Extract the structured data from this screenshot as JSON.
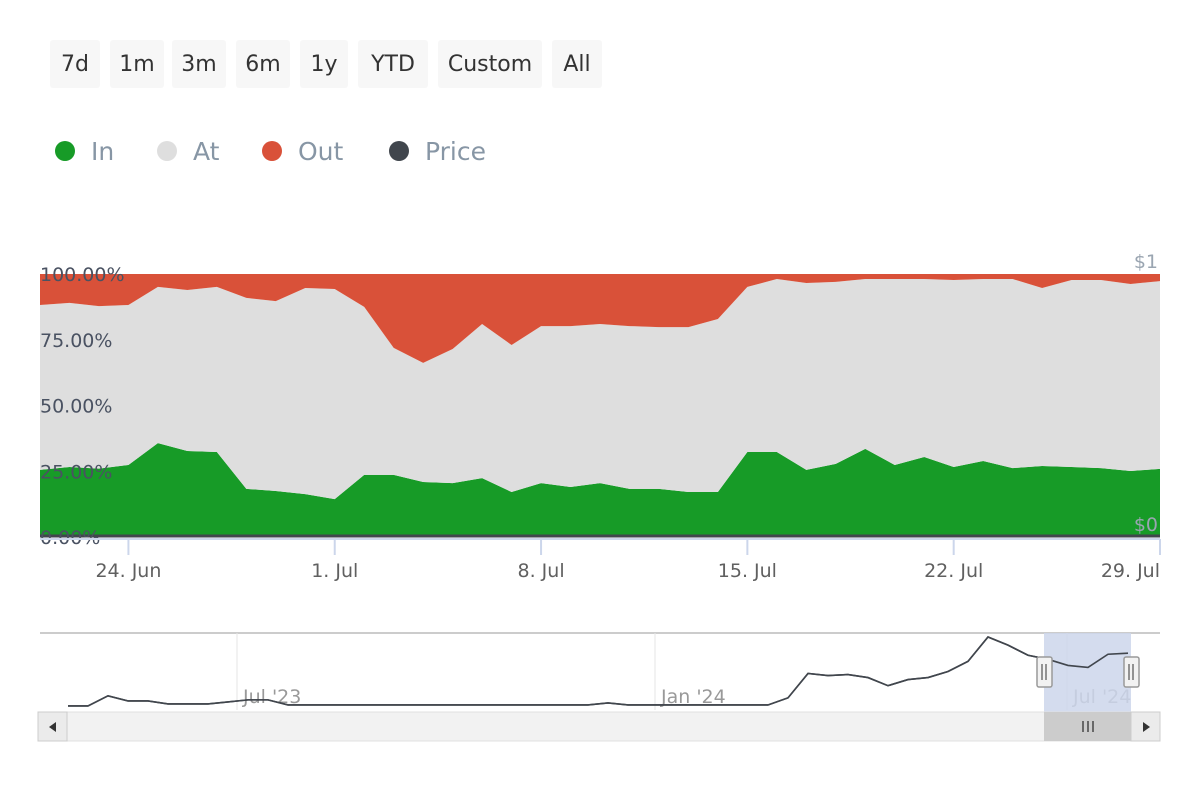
{
  "range_selector": {
    "buttons": [
      "7d",
      "1m",
      "3m",
      "6m",
      "1y",
      "YTD",
      "Custom",
      "All"
    ]
  },
  "legend": {
    "items": [
      {
        "label": "In",
        "color": "#179b27"
      },
      {
        "label": "At",
        "color": "#dedede"
      },
      {
        "label": "Out",
        "color": "#d95139"
      },
      {
        "label": "Price",
        "color": "#41464d"
      }
    ]
  },
  "chart_data": {
    "type": "area",
    "stacking": "percent",
    "x": [
      "21. Jun",
      "22. Jun",
      "23. Jun",
      "24. Jun",
      "25. Jun",
      "26. Jun",
      "27. Jun",
      "28. Jun",
      "29. Jun",
      "30. Jun",
      "1. Jul",
      "2. Jul",
      "3. Jul",
      "4. Jul",
      "5. Jul",
      "6. Jul",
      "7. Jul",
      "8. Jul",
      "9. Jul",
      "10. Jul",
      "11. Jul",
      "12. Jul",
      "13. Jul",
      "14. Jul",
      "15. Jul",
      "16. Jul",
      "17. Jul",
      "18. Jul",
      "19. Jul",
      "20. Jul",
      "21. Jul",
      "22. Jul",
      "23. Jul",
      "24. Jul",
      "25. Jul",
      "26. Jul",
      "27. Jul",
      "28. Jul",
      "29. Jul"
    ],
    "x_ticks": [
      "24. Jun",
      "1. Jul",
      "8. Jul",
      "15. Jul",
      "22. Jul",
      "29. Jul"
    ],
    "y_ticks": [
      "0.00%",
      "25.00%",
      "50.00%",
      "75.00%",
      "100.00%"
    ],
    "ylim": [
      0,
      100
    ],
    "y2_ticks": [
      "$0",
      "$1"
    ],
    "y2lim": [
      0,
      1
    ],
    "series": [
      {
        "name": "In",
        "color": "#179b27",
        "values": [
          25.5,
          26.6,
          26.0,
          27.4,
          35.7,
          32.7,
          32.3,
          18.3,
          17.5,
          16.3,
          14.4,
          23.6,
          23.6,
          20.9,
          20.5,
          22.4,
          17.1,
          20.5,
          19.0,
          20.5,
          18.3,
          18.3,
          17.1,
          17.1,
          32.3,
          32.3,
          25.5,
          27.8,
          33.5,
          27.4,
          30.4,
          26.6,
          28.9,
          26.2,
          27.0,
          26.6,
          26.2,
          25.1,
          25.9
        ]
      },
      {
        "name": "At",
        "color": "#dedede",
        "values": [
          62.7,
          62.4,
          61.8,
          60.8,
          59.4,
          61.2,
          62.8,
          72.6,
          72.2,
          78.4,
          79.9,
          63.9,
          48.3,
          45.3,
          51.0,
          58.6,
          55.9,
          59.7,
          61.2,
          60.5,
          61.9,
          61.5,
          62.7,
          65.8,
          62.8,
          65.8,
          71.1,
          69.2,
          64.6,
          70.7,
          67.7,
          71.1,
          69.2,
          71.9,
          67.7,
          71.1,
          71.5,
          71.1,
          71.4
        ]
      },
      {
        "name": "Out",
        "color": "#d95139",
        "values": [
          11.8,
          11.0,
          12.2,
          11.8,
          4.9,
          6.1,
          4.9,
          9.1,
          10.3,
          5.3,
          5.7,
          12.5,
          28.1,
          33.8,
          28.5,
          19.0,
          27.0,
          19.8,
          19.8,
          19.0,
          19.8,
          20.2,
          20.2,
          17.1,
          4.9,
          1.9,
          3.4,
          3.0,
          1.9,
          1.9,
          1.9,
          2.3,
          1.9,
          1.9,
          5.3,
          2.3,
          2.3,
          3.8,
          2.7
        ]
      },
      {
        "name": "Price",
        "color": "#41464d",
        "axis": "right",
        "values": [
          0,
          0,
          0,
          0,
          0,
          0,
          0,
          0,
          0,
          0,
          0,
          0,
          0,
          0,
          0,
          0,
          0,
          0,
          0,
          0,
          0,
          0,
          0,
          0,
          0,
          0,
          0,
          0,
          0,
          0,
          0,
          0,
          0,
          0,
          0,
          0,
          0,
          0,
          0
        ]
      }
    ],
    "grid": false,
    "legend_placement": "top-left"
  },
  "navigator": {
    "x_ticks": [
      "Jul '23",
      "Jan '24",
      "Jul '24"
    ],
    "price_relative": [
      2,
      2,
      12,
      7,
      7,
      4,
      4,
      4,
      6,
      8,
      8,
      3,
      3,
      3,
      3,
      3,
      3,
      3,
      3,
      3,
      3,
      3,
      3,
      3,
      3,
      3,
      3,
      5,
      3,
      3,
      3,
      3,
      3,
      3,
      3,
      3,
      10,
      34,
      32,
      33,
      30,
      22,
      28,
      30,
      36,
      46,
      70,
      62,
      52,
      48,
      42,
      40,
      53,
      54
    ],
    "selection_color": "#ccd6eb"
  }
}
